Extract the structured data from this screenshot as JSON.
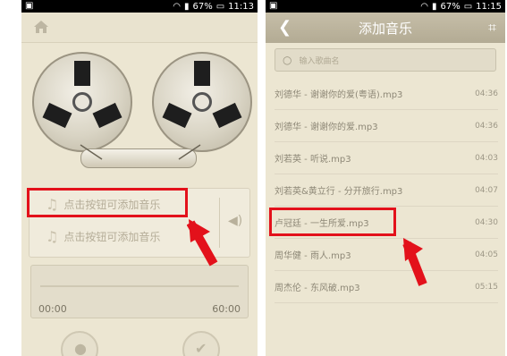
{
  "left_screen": {
    "status": {
      "battery": "67%",
      "time": "11:13"
    },
    "add_music_1": "点击按钮可添加音乐",
    "add_music_2": "点击按钮可添加音乐",
    "time_start": "00:00",
    "time_end": "60:00"
  },
  "right_screen": {
    "status": {
      "battery": "67%",
      "time": "11:15"
    },
    "title": "添加音乐",
    "search_placeholder": "输入歌曲名",
    "songs": [
      {
        "name": "刘德华 - 谢谢你的爱(粤语).mp3",
        "duration": "04:36"
      },
      {
        "name": "刘德华 - 谢谢你的爱.mp3",
        "duration": "04:36"
      },
      {
        "name": "刘若英 - 听说.mp3",
        "duration": "04:03"
      },
      {
        "name": "刘若英&黄立行 - 分开旅行.mp3",
        "duration": "04:07"
      },
      {
        "name": "卢冠廷 - 一生所爱.mp3",
        "duration": "04:30"
      },
      {
        "name": "周华健 - 雨人.mp3",
        "duration": "04:05"
      },
      {
        "name": "周杰伦 - 东风破.mp3",
        "duration": "05:15"
      }
    ]
  },
  "colors": {
    "annotation": "#e3111b",
    "background": "#ece6d2"
  }
}
